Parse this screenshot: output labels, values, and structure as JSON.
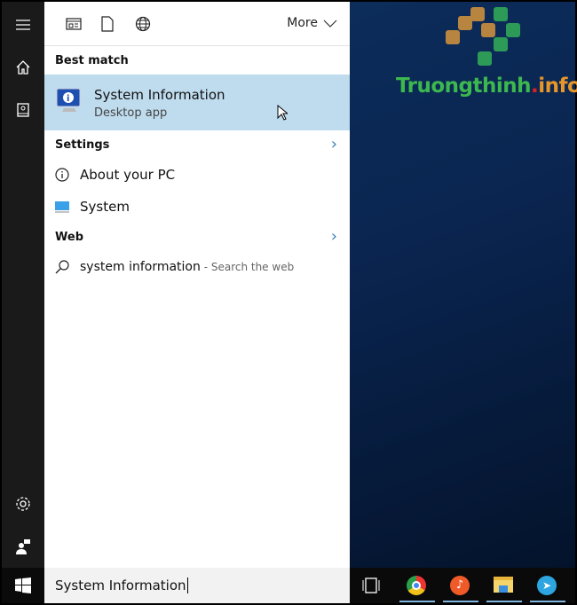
{
  "toolbar": {
    "more_label": "More",
    "icons": [
      "apps-icon",
      "documents-icon",
      "web-icon"
    ]
  },
  "rail": {
    "icons": [
      "hamburger-menu-icon",
      "home-icon",
      "notebook-icon",
      "settings-gear-icon",
      "feedback-icon"
    ]
  },
  "best_match": {
    "header": "Best match",
    "title": "System Information",
    "subtitle": "Desktop app"
  },
  "settings": {
    "header": "Settings",
    "items": [
      {
        "label": "About your PC",
        "icon": "info-icon"
      },
      {
        "label": "System",
        "icon": "monitor-icon"
      }
    ]
  },
  "web": {
    "header": "Web",
    "query": "system information",
    "suffix": " - Search the web"
  },
  "search": {
    "value": "System Information"
  },
  "watermark": {
    "text_main": "Truongthinh",
    "text_dot": ".",
    "text_tld": "info"
  },
  "taskbar": {
    "apps": [
      "task-view-icon",
      "chrome-icon",
      "music-icon",
      "file-explorer-icon",
      "telegram-icon"
    ]
  },
  "colors": {
    "highlight": "#bfdcef",
    "accent": "#3a7fb8"
  }
}
